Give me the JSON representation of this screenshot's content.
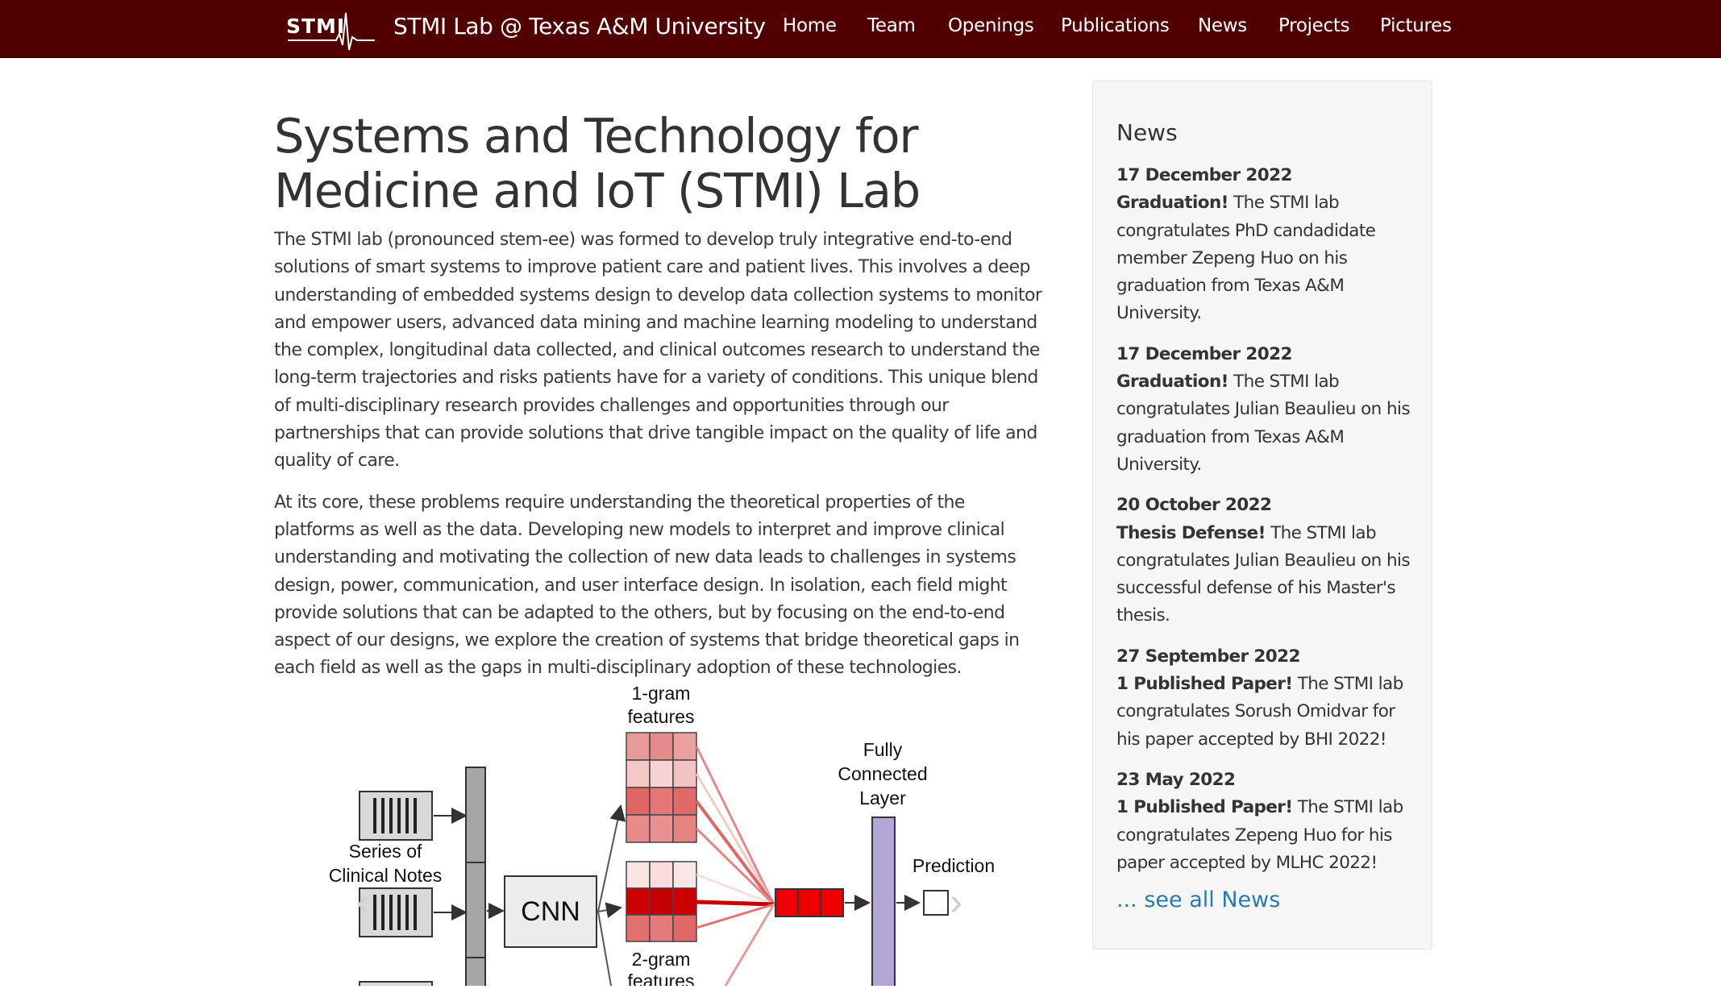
{
  "header": {
    "logo_text": "STMI",
    "brand": "STMI Lab @ Texas A&M University",
    "nav": [
      "Home",
      "Team",
      "Openings",
      "Publications",
      "News",
      "Projects",
      "Pictures"
    ]
  },
  "main": {
    "title_line1": "Systems and Technology for",
    "title_line2": "Medicine and IoT (STMI) Lab",
    "paragraph1": "The STMI lab (pronounced stem-ee) was formed to develop truly integrative end-to-end solutions of smart systems to improve patient care and patient lives. This involves a deep understanding of embedded systems design to develop data collection systems to monitor and empower users, advanced data mining and machine learning modeling to understand the complex, longitudinal data collected, and clinical outcomes research to understand the long-term trajectories and risks patients have for a variety of conditions. This unique blend of multi-disciplinary research provides challenges and opportunities through our partnerships that can provide solutions that drive tangible impact on the quality of life and quality of care.",
    "paragraph2": "At its core, these problems require understanding the theoretical properties of the platforms as well as the data. Developing new models to interpret and improve clinical understanding and motivating the collection of new data leads to challenges in systems design, power, communication, and user interface design. In isolation, each field might provide solutions that can be adapted to the others, but by focusing on the end-to-end aspect of our designs, we explore the creation of systems that bridge theoretical gaps in each field as well as the gaps in multi-disciplinary adoption of these technologies."
  },
  "figure": {
    "notes_label_1": "Series of",
    "notes_label_2": "Clinical Notes",
    "cnn_label": "CNN",
    "one_gram_1": "1-gram",
    "one_gram_2": "features",
    "two_gram_1": "2-gram",
    "two_gram_2": "features",
    "fc_1": "Fully",
    "fc_2": "Connected",
    "fc_3": "Layer",
    "prediction": "Prediction"
  },
  "sidebar": {
    "heading": "News",
    "items": [
      {
        "date": "17 December 2022",
        "title": "Graduation!",
        "text": " The STMI lab congratulates PhD candadidate member Zepeng Huo on his graduation from Texas A&M University."
      },
      {
        "date": "17 December 2022",
        "title": "Graduation!",
        "text": " The STMI lab congratulates Julian Beaulieu on his graduation from Texas A&M University."
      },
      {
        "date": "20 October 2022",
        "title": "Thesis Defense!",
        "text": " The STMI lab congratulates Julian Beaulieu on his successful defense of his Master's thesis."
      },
      {
        "date": "27 September 2022",
        "title": "1 Published Paper!",
        "text": " The STMI lab congratulates Sorush Omidvar for his paper accepted by BHI 2022!"
      },
      {
        "date": "23 May 2022",
        "title": "1 Published Paper!",
        "text": " The STMI lab congratulates Zepeng Huo for his paper accepted by MLHC 2022!"
      }
    ],
    "see_all": "... see all News"
  }
}
